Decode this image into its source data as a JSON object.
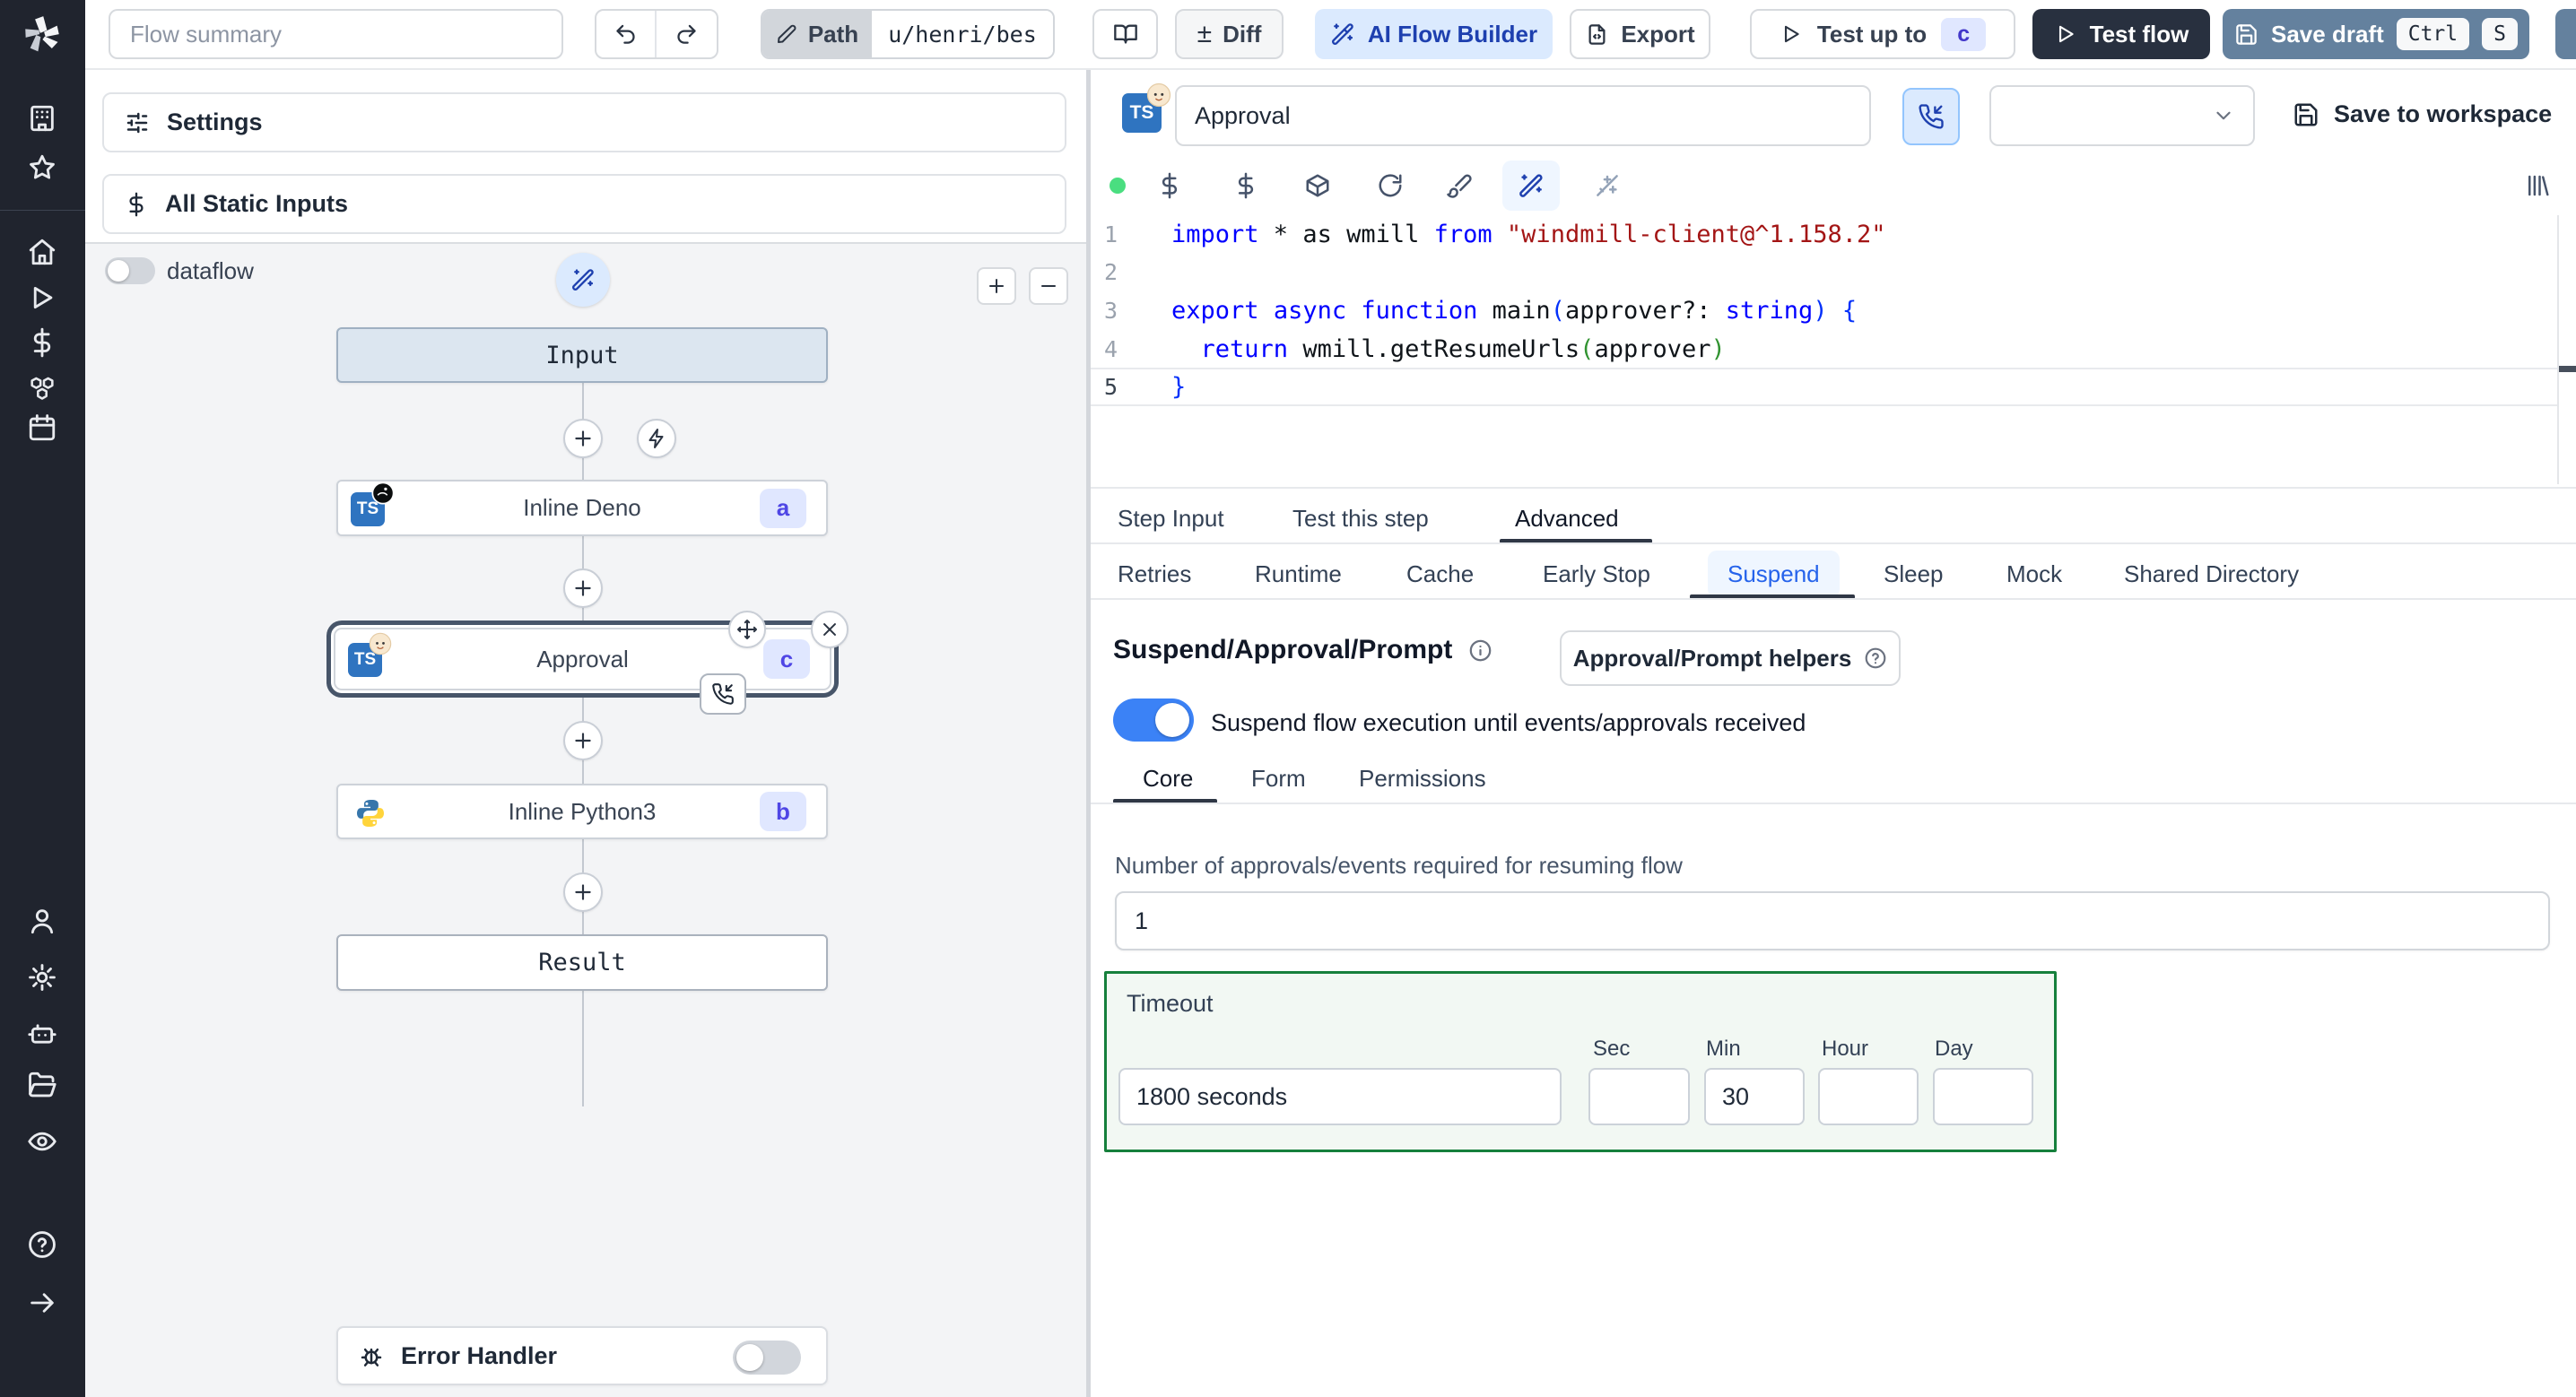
{
  "topbar": {
    "flow_summary_placeholder": "Flow summary",
    "path_label": "Path",
    "path_value": "u/henri/bes",
    "diff_label": "Diff",
    "ai_flow_builder_label": "AI Flow Builder",
    "export_label": "Export",
    "test_up_to_label": "Test up to",
    "test_up_to_badge": "c",
    "test_flow_label": "Test flow",
    "save_draft_label": "Save draft",
    "save_draft_kbd_1": "Ctrl",
    "save_draft_kbd_2": "S"
  },
  "sidebar": {
    "icons": [
      "building",
      "star",
      "home",
      "play",
      "dollar",
      "boxes",
      "calendar",
      "user",
      "settings",
      "bot",
      "folder-open",
      "eye",
      "help",
      "arrow-right"
    ]
  },
  "left_panel": {
    "settings_label": "Settings",
    "all_static_inputs_label": "All Static Inputs",
    "dataflow_label": "dataflow",
    "dataflow_on": false,
    "graph": {
      "input_label": "Input",
      "result_label": "Result",
      "steps": [
        {
          "label": "Inline Deno",
          "badge": "a",
          "lang_badge": "TS",
          "icon": "deno"
        },
        {
          "label": "Approval",
          "badge": "c",
          "lang_badge": "TS",
          "icon": "baby-face",
          "selected": true
        },
        {
          "label": "Inline Python3",
          "badge": "b",
          "icon": "python"
        }
      ],
      "error_handler_label": "Error Handler",
      "error_handler_on": false
    }
  },
  "step_editor": {
    "lang_badge": "TS",
    "name_value": "Approval",
    "workspace_dropdown_value": "",
    "save_to_workspace_label": "Save to workspace",
    "code": {
      "lines": [
        {
          "num": "1",
          "tokens": [
            {
              "t": "import",
              "c": "kw"
            },
            {
              "t": " * as wmill ",
              "c": "pl"
            },
            {
              "t": "from",
              "c": "kw"
            },
            {
              "t": " ",
              "c": "pl"
            },
            {
              "t": "\"windmill-client@^1.158.2\"",
              "c": "str"
            }
          ]
        },
        {
          "num": "2",
          "tokens": []
        },
        {
          "num": "3",
          "tokens": [
            {
              "t": "export",
              "c": "kw"
            },
            {
              "t": " ",
              "c": "pl"
            },
            {
              "t": "async",
              "c": "kw"
            },
            {
              "t": " ",
              "c": "pl"
            },
            {
              "t": "function",
              "c": "kw"
            },
            {
              "t": " main",
              "c": "pl"
            },
            {
              "t": "(",
              "c": "p1"
            },
            {
              "t": "approver?: ",
              "c": "pl"
            },
            {
              "t": "string",
              "c": "kw"
            },
            {
              "t": ")",
              "c": "p1"
            },
            {
              "t": " ",
              "c": "pl"
            },
            {
              "t": "{",
              "c": "p1"
            }
          ]
        },
        {
          "num": "4",
          "tokens": [
            {
              "t": "  ",
              "c": "pl"
            },
            {
              "t": "return",
              "c": "kw"
            },
            {
              "t": " wmill.getResumeUrls",
              "c": "pl"
            },
            {
              "t": "(",
              "c": "p2"
            },
            {
              "t": "approver",
              "c": "pl"
            },
            {
              "t": ")",
              "c": "p2"
            }
          ]
        },
        {
          "num": "5",
          "active": true,
          "tokens": [
            {
              "t": "}",
              "c": "p1"
            }
          ]
        }
      ]
    },
    "tabs": [
      "Step Input",
      "Test this step",
      "Advanced"
    ],
    "active_tab": "Advanced",
    "advanced_tabs": [
      "Retries",
      "Runtime",
      "Cache",
      "Early Stop",
      "Suspend",
      "Sleep",
      "Mock",
      "Shared Directory"
    ],
    "active_advanced_tab": "Suspend",
    "suspend": {
      "heading": "Suspend/Approval/Prompt",
      "helpers_button_label": "Approval/Prompt helpers",
      "toggle_label": "Suspend flow execution until events/approvals received",
      "suspend_enabled": true,
      "tabs": [
        "Core",
        "Form",
        "Permissions"
      ],
      "active_sub_tab": "Core",
      "approvals_label": "Number of approvals/events required for resuming flow",
      "approvals_value": "1",
      "timeout": {
        "label": "Timeout",
        "value": "1800 seconds",
        "units": [
          {
            "label": "Sec",
            "value": ""
          },
          {
            "label": "Min",
            "value": "30"
          },
          {
            "label": "Hour",
            "value": ""
          },
          {
            "label": "Day",
            "value": ""
          }
        ]
      }
    }
  },
  "colors": {
    "sidebar_bg": "#20242e",
    "accent_blue": "#3b82f6",
    "ai_button_bg": "#dbeafe",
    "ai_button_text": "#1e40af",
    "save_draft_bg": "#64819e",
    "dark_button_bg": "#28303f",
    "badge_bg": "#e0e7ff",
    "badge_text": "#4f46e5",
    "status_dot_green": "#4ade80",
    "timeout_border": "#16803c",
    "timeout_bg": "#f2f8f3",
    "suspend_tab_text": "#2563eb",
    "selected_node_ring": "#475569"
  }
}
